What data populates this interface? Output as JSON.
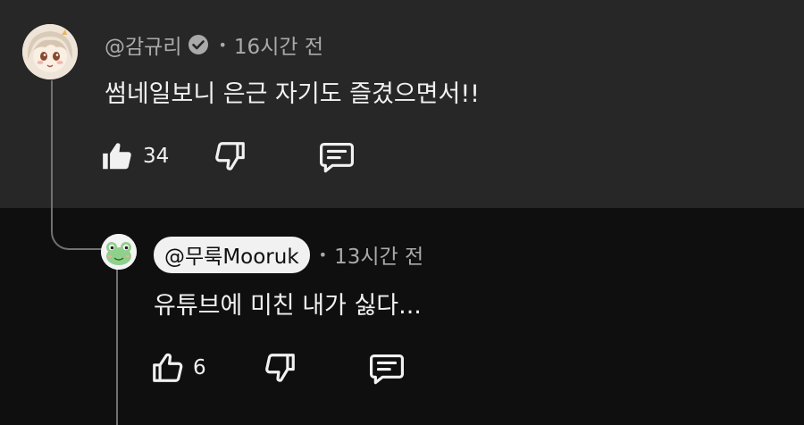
{
  "colors": {
    "background": "#0f0f0f",
    "highlighted_background": "#272727",
    "meta_text": "#aaaaaa",
    "primary_text": "#f1f1f1",
    "thread_line": "#717171"
  },
  "comment": {
    "author": "@감규리",
    "verified_icon": "verified-check-icon",
    "separator": "•",
    "time": "16시간 전",
    "text": "썸네일보니 은근 자기도 즐겼으면서!!",
    "like_count": "34",
    "like_state": "liked"
  },
  "reply": {
    "author": "@무룩Mooruk",
    "separator": "•",
    "time": "13시간 전",
    "text": "유튜브에 미친 내가 싫다...",
    "like_count": "6",
    "like_state": "not-liked"
  }
}
